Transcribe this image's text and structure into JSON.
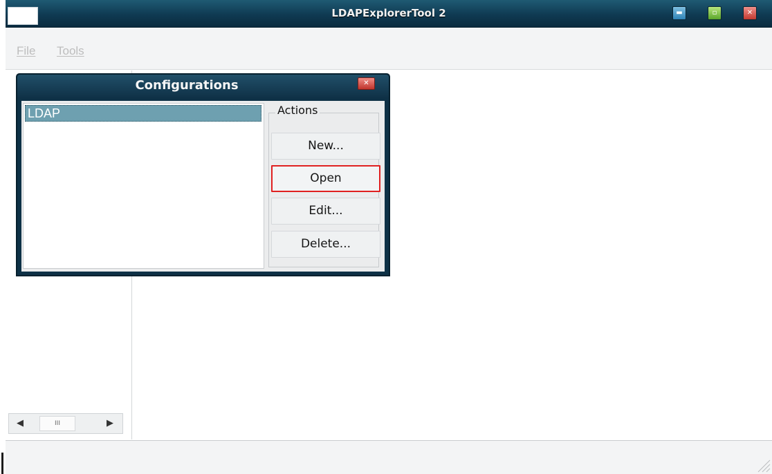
{
  "window": {
    "title": "LDAPExplorerTool 2",
    "controls": {
      "minimize": "▬",
      "maximize": "▫",
      "close": "✕"
    }
  },
  "menu": {
    "file": "File",
    "tools": "Tools"
  },
  "scrollbar": {
    "left_arrow": "◀",
    "right_arrow": "▶",
    "thumb_grip": "III"
  },
  "dialog": {
    "title": "Configurations",
    "close_glyph": "✕",
    "list": {
      "items": [
        "LDAP"
      ],
      "selected": "LDAP"
    },
    "actions": {
      "legend": "Actions",
      "new": "New...",
      "open": "Open",
      "edit": "Edit...",
      "delete": "Delete..."
    },
    "highlighted_button": "Open",
    "highlight_color": "#e02020"
  },
  "colors": {
    "titlebar": "#0f3a52",
    "selection": "#6ea0b0",
    "menu_text_disabled": "#bdbdbd"
  }
}
